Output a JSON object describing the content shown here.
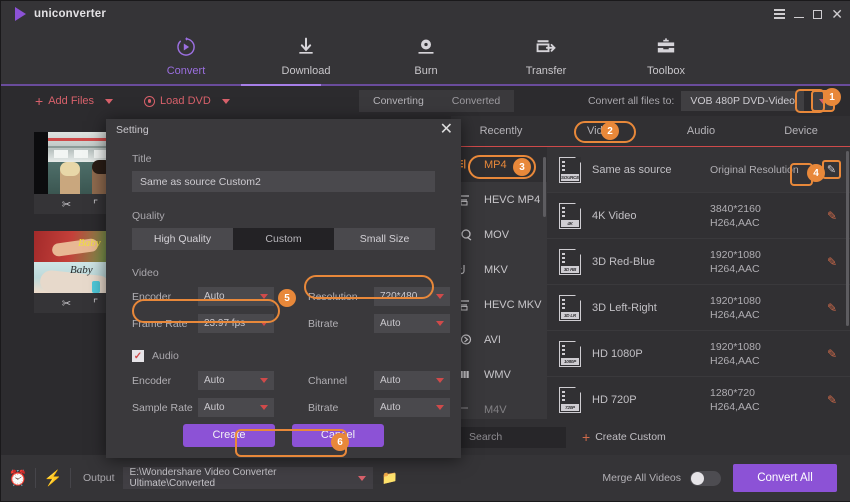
{
  "window": {
    "app_title": "uniconverter",
    "controls": {
      "menu": "menu-icon",
      "minimize": "_",
      "maximize": "maximize-icon",
      "close": "✕"
    }
  },
  "nav": {
    "items": [
      {
        "label": "Convert",
        "icon": "convert-icon",
        "active": true
      },
      {
        "label": "Download",
        "icon": "download-icon",
        "active": false
      },
      {
        "label": "Burn",
        "icon": "burn-icon",
        "active": false
      },
      {
        "label": "Transfer",
        "icon": "transfer-icon",
        "active": false
      },
      {
        "label": "Toolbox",
        "icon": "toolbox-icon",
        "active": false
      }
    ]
  },
  "toolbar": {
    "add_files": "Add Files",
    "load_dvd": "Load DVD",
    "tab_converting": "Converting",
    "tab_converted": "Converted",
    "convert_all_label": "Convert all files to:",
    "convert_all_value": "VOB 480P DVD-Video"
  },
  "format_panel": {
    "tabs": [
      "Recently",
      "Video",
      "Audio",
      "Device"
    ],
    "active_tab": "Video",
    "formats": [
      {
        "label": "MP4",
        "selected": true
      },
      {
        "label": "HEVC MP4",
        "selected": false
      },
      {
        "label": "MOV",
        "selected": false
      },
      {
        "label": "MKV",
        "selected": false
      },
      {
        "label": "HEVC MKV",
        "selected": false
      },
      {
        "label": "AVI",
        "selected": false
      },
      {
        "label": "WMV",
        "selected": false
      },
      {
        "label": "M4V",
        "selected": false
      }
    ],
    "resolutions": [
      {
        "name": "Same as source",
        "tag": "SOURCE",
        "spec1": "Original Resolution",
        "spec2": "",
        "selected": true
      },
      {
        "name": "4K Video",
        "tag": "4K",
        "spec1": "3840*2160",
        "spec2": "H264,AAC",
        "selected": false
      },
      {
        "name": "3D Red-Blue",
        "tag": "3D RB",
        "spec1": "1920*1080",
        "spec2": "H264,AAC",
        "selected": false
      },
      {
        "name": "3D Left-Right",
        "tag": "3D LR",
        "spec1": "1920*1080",
        "spec2": "H264,AAC",
        "selected": false
      },
      {
        "name": "HD 1080P",
        "tag": "1080P",
        "spec1": "1920*1080",
        "spec2": "H264,AAC",
        "selected": false
      },
      {
        "name": "HD 720P",
        "tag": "720P",
        "spec1": "1280*720",
        "spec2": "H264,AAC",
        "selected": false
      }
    ],
    "search_placeholder": "Search",
    "create_custom": "Create Custom"
  },
  "dialog": {
    "title": "Setting",
    "close": "✕",
    "title_label": "Title",
    "title_value": "Same as source Custom2",
    "quality_label": "Quality",
    "quality_options": [
      {
        "label": "High Quality",
        "active": false
      },
      {
        "label": "Custom",
        "active": true
      },
      {
        "label": "Small Size",
        "active": false
      }
    ],
    "video_section": "Video",
    "video_fields": [
      {
        "label": "Encoder",
        "value": "Auto"
      },
      {
        "label": "Resolution",
        "value": "720*480"
      },
      {
        "label": "Frame Rate",
        "value": "23.97 fps"
      },
      {
        "label": "Bitrate",
        "value": "Auto"
      }
    ],
    "audio_section": "Audio",
    "audio_checked": true,
    "audio_fields": [
      {
        "label": "Encoder",
        "value": "Auto"
      },
      {
        "label": "Channel",
        "value": "Auto"
      },
      {
        "label": "Sample Rate",
        "value": "Auto"
      },
      {
        "label": "Bitrate",
        "value": "Auto"
      }
    ],
    "create_button": "Create",
    "cancel_button": "Cancel"
  },
  "bottom": {
    "timer_icon": "alarm-clock-icon",
    "bolt_icon": "lightning-icon",
    "output_label": "Output",
    "output_path": "E:\\Wondershare Video Converter Ultimate\\Converted",
    "merge_label": "Merge All Videos",
    "merge_on": false,
    "convert_all_button": "Convert All"
  },
  "annotations": [
    {
      "number": "1",
      "target": "convert-all-dropdown"
    },
    {
      "number": "2",
      "target": "video-tab"
    },
    {
      "number": "3",
      "target": "mp4-format"
    },
    {
      "number": "4",
      "target": "edit-same-as-source"
    },
    {
      "number": "5",
      "target": "resolution-framerate"
    },
    {
      "number": "6",
      "target": "create-button"
    }
  ],
  "colors": {
    "accent_purple": "#8c52d6",
    "accent_orange": "#e8883a",
    "accent_red": "#cf4a4a",
    "bg_dark": "#2c2b2e",
    "bg_panel": "#313033"
  }
}
